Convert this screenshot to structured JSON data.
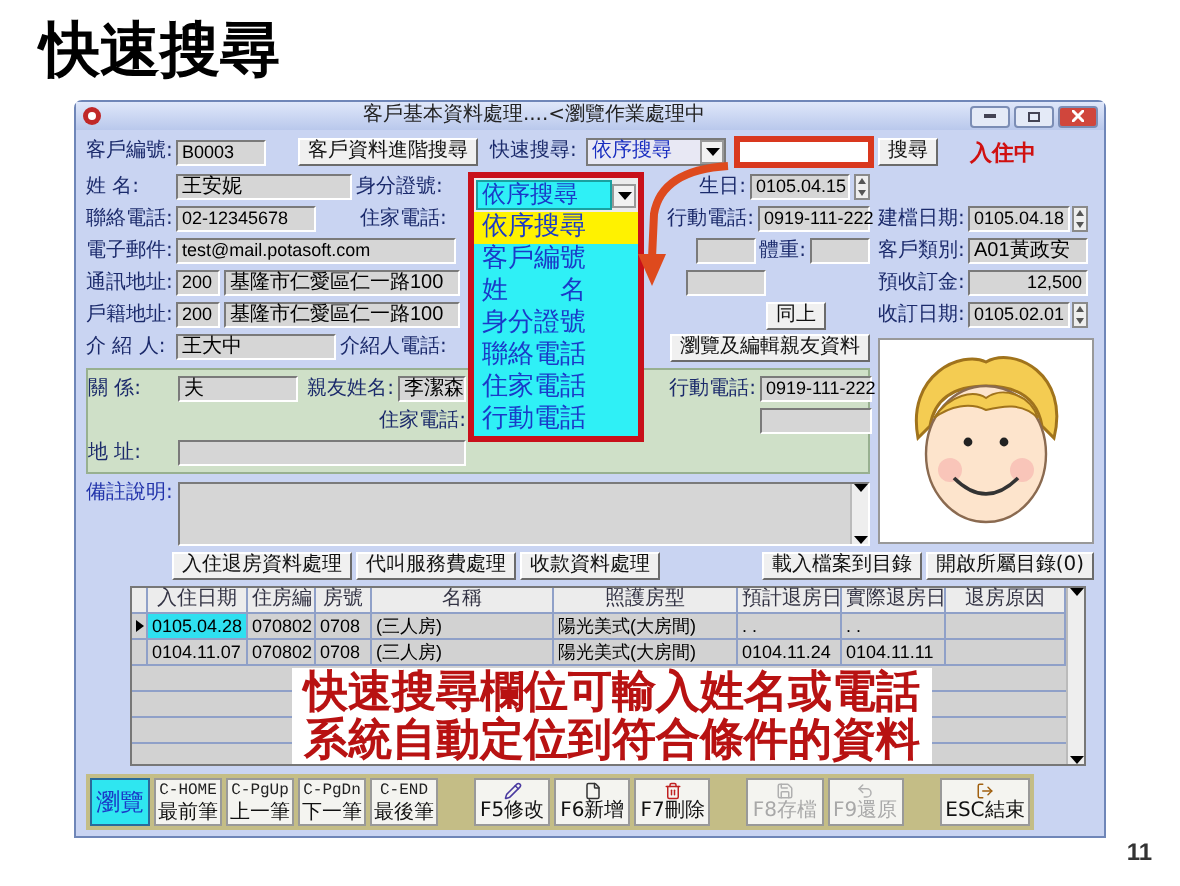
{
  "slide": {
    "title": "快速搜尋",
    "page_number": "11"
  },
  "window": {
    "title": "客戶基本資料處理....<瀏覽作業處理中"
  },
  "header": {
    "id_label": "客戶編號:",
    "id_value": "B0003",
    "advanced_search": "客戶資料進階搜尋",
    "quick_search_label": "快速搜尋:",
    "quick_search_mode": "依序搜尋",
    "search_button": "搜尋",
    "status": "入住中"
  },
  "quick_search_dropdown": {
    "value": "依序搜尋",
    "options": [
      {
        "label": "依序搜尋",
        "selected": true
      },
      {
        "label": "客戶編號",
        "selected": false
      },
      {
        "label": "姓　　名",
        "selected": false
      },
      {
        "label": "身分證號",
        "selected": false
      },
      {
        "label": "聯絡電話",
        "selected": false
      },
      {
        "label": "住家電話",
        "selected": false
      },
      {
        "label": "行動電話",
        "selected": false
      }
    ]
  },
  "form": {
    "name": {
      "label": "姓 名:",
      "value": "王安妮"
    },
    "id_number": {
      "label": "身分證號:"
    },
    "birthday": {
      "label": "生日:",
      "value": "0105.04.15"
    },
    "contact_phone": {
      "label": "聯絡電話:",
      "value": "02-12345678"
    },
    "home_phone": {
      "label": "住家電話:"
    },
    "mobile_phone": {
      "label": "行動電話:",
      "value": "0919-111-222"
    },
    "email": {
      "label": "電子郵件:",
      "value": "test@mail.potasoft.com"
    },
    "weight": {
      "label": "體重:"
    },
    "mailing_address": {
      "label": "通訊地址:",
      "zip": "200",
      "address": "基隆市仁愛區仁一路100"
    },
    "registered_address": {
      "label": "戶籍地址:",
      "zip": "200",
      "address": "基隆市仁愛區仁一路100",
      "button": "同上"
    },
    "referrer": {
      "label": "介 紹 人:",
      "value": "王大中"
    },
    "referrer_phone": {
      "label": "介紹人電話:"
    },
    "relatives_button": "瀏覽及編輯親友資料"
  },
  "relative": {
    "relation": {
      "label": "關 係:",
      "value": "夫"
    },
    "name": {
      "label": "親友姓名:",
      "value": "李潔森"
    },
    "mobile_phone": {
      "label": "行動電話:",
      "value": "0919-111-222"
    },
    "home_phone": {
      "label": "住家電話:"
    },
    "address": {
      "label": "地 址:"
    }
  },
  "remarks": {
    "label": "備註說明:"
  },
  "side_fields": [
    {
      "label": "建檔日期:",
      "value": "0105.04.18",
      "kind": "date"
    },
    {
      "label": "客戶類別:",
      "value": "A01黃政安",
      "kind": "text"
    },
    {
      "label": "預收訂金:",
      "value": "12,500",
      "kind": "amount"
    },
    {
      "label": "收訂日期:",
      "value": "0105.02.01",
      "kind": "date"
    }
  ],
  "action_buttons": [
    "入住退房資料處理",
    "代叫服務費處理",
    "收款資料處理"
  ],
  "file_buttons": [
    "載入檔案到目錄",
    "開啟所屬目錄(0)"
  ],
  "table": {
    "columns": [
      "入住日期",
      "住房編",
      "房號",
      "名稱",
      "照護房型",
      "預計退房日",
      "實際退房日",
      "退房原因"
    ],
    "rows": [
      {
        "selected": true,
        "cells": [
          "0105.04.28",
          "070802",
          "0708",
          "(三人房)",
          "陽光美式(大房間)",
          ". .",
          ". .",
          ""
        ]
      },
      {
        "selected": false,
        "cells": [
          "0104.11.07",
          "070802",
          "0708",
          "(三人房)",
          "陽光美式(大房間)",
          "0104.11.24",
          "0104.11.11",
          ""
        ]
      }
    ]
  },
  "callout": {
    "lines": [
      "快速搜尋欄位可輸入姓名或電話",
      "系統自動定位到符合條件的資料"
    ]
  },
  "toolbar": {
    "mode": "瀏覽",
    "nav": [
      {
        "key": "C-HOME",
        "label": "最前筆"
      },
      {
        "key": "C-PgUp",
        "label": "上一筆"
      },
      {
        "key": "C-PgDn",
        "label": "下一筆"
      },
      {
        "key": "C-END",
        "label": "最後筆"
      }
    ],
    "actions": [
      {
        "label": "F5修改",
        "disabled": false
      },
      {
        "label": "F6新增",
        "disabled": false
      },
      {
        "label": "F7刪除",
        "disabled": false
      },
      {
        "label": "F8存檔",
        "disabled": true
      },
      {
        "label": "F9還原",
        "disabled": true
      },
      {
        "label": "ESC結束",
        "disabled": false
      }
    ]
  }
}
